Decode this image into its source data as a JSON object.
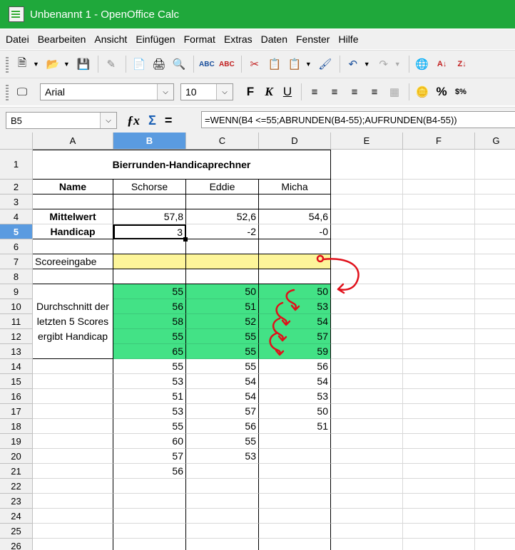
{
  "window": {
    "title": "Unbenannt 1 - OpenOffice Calc"
  },
  "menu": [
    "Datei",
    "Bearbeiten",
    "Ansicht",
    "Einfügen",
    "Format",
    "Extras",
    "Daten",
    "Fenster",
    "Hilfe"
  ],
  "font": {
    "name": "Arial",
    "size": "10"
  },
  "namebox": "B5",
  "formula": "=WENN(B4 <=55;ABRUNDEN(B4-55);AUFRUNDEN(B4-55))",
  "format_buttons": {
    "bold": "F",
    "italic": "K",
    "underline": "U",
    "currency": "%",
    "percent_label": "%"
  },
  "columns": [
    "A",
    "B",
    "C",
    "D",
    "E",
    "F",
    "G"
  ],
  "rows": [
    "1",
    "2",
    "3",
    "4",
    "5",
    "6",
    "7",
    "8",
    "9",
    "10",
    "11",
    "12",
    "13",
    "14",
    "15",
    "16",
    "17",
    "18",
    "19",
    "20",
    "21",
    "22",
    "23",
    "24",
    "25",
    "26"
  ],
  "sheet": {
    "title": "Bierrunden-Handicaprechner",
    "name_label": "Name",
    "players": [
      "Schorse",
      "Eddie",
      "Micha"
    ],
    "mittelwert_label": "Mittelwert",
    "mittelwert": [
      "57,8",
      "52,6",
      "54,6"
    ],
    "handicap_label": "Handicap",
    "handicap": [
      "3",
      "-2",
      "-0"
    ],
    "scoreeingabe_label": "Scoreeingabe",
    "note_label": "Durchschnitt der letzten 5 Scores ergibt Handicap",
    "scores": {
      "B": [
        "55",
        "56",
        "58",
        "55",
        "65",
        "55",
        "53",
        "51",
        "53",
        "55",
        "60",
        "57",
        "56"
      ],
      "C": [
        "50",
        "51",
        "52",
        "55",
        "55",
        "55",
        "54",
        "54",
        "57",
        "56",
        "55",
        "53"
      ],
      "D": [
        "50",
        "53",
        "54",
        "57",
        "59",
        "56",
        "54",
        "53",
        "50",
        "51"
      ]
    }
  },
  "colors": {
    "titlebar": "#1fa83b",
    "highlight_green": "#43e286",
    "input_yellow": "#fdf59a",
    "annotation_red": "#e0101a",
    "selected_header": "#5a9be0"
  }
}
